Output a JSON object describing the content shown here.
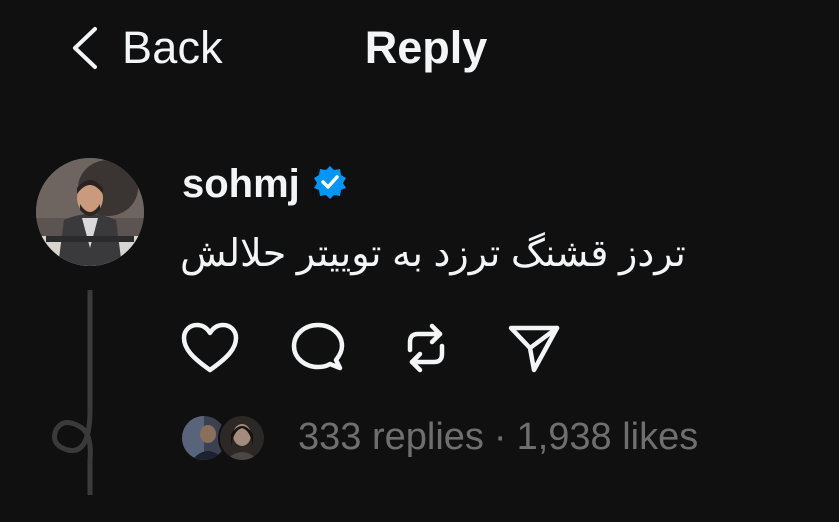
{
  "header": {
    "back_label": "Back",
    "title": "Reply"
  },
  "post": {
    "username": "sohmj",
    "verified": true,
    "text": "تردز قشنگ ترزد به توییتر حلالش",
    "replies": "333 replies",
    "separator": "·",
    "likes": "1,938 likes"
  },
  "icons": {
    "back": "chevron-left-icon",
    "verified": "verified-badge-icon",
    "like": "heart-icon",
    "comment": "comment-bubble-icon",
    "repost": "repost-icon",
    "share": "send-icon"
  },
  "colors": {
    "background": "#101010",
    "text": "#f3f5f7",
    "muted": "#6f6f6f",
    "verified": "#0095f6",
    "thread_line": "#3a3a3a"
  }
}
